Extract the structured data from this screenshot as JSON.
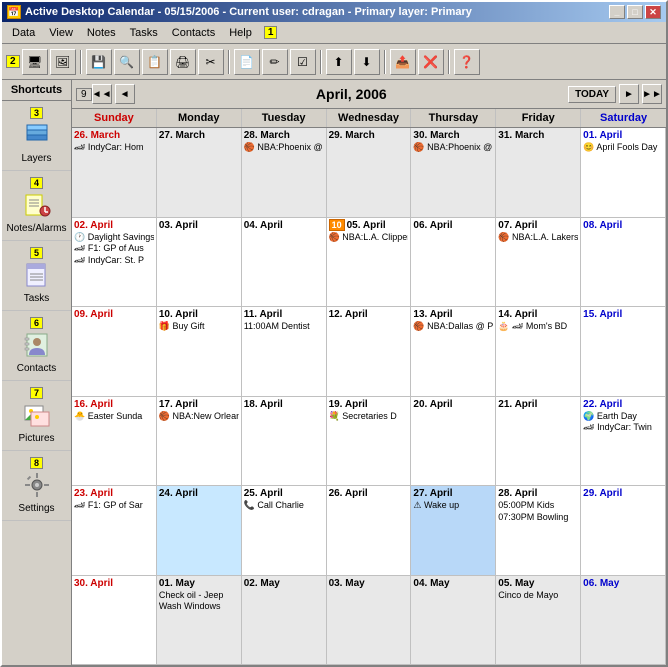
{
  "window": {
    "title": "Active Desktop Calendar - 05/15/2006 - Current user: cdragan - Primary layer: Primary",
    "icon": "📅"
  },
  "titlebar_buttons": [
    "_",
    "□",
    "✕"
  ],
  "menubar": {
    "items": [
      "Data",
      "View",
      "Notes",
      "Tasks",
      "Contacts",
      "Help"
    ],
    "badge": "1"
  },
  "toolbar": {
    "badge": "2",
    "buttons": [
      "🖥",
      "🖼",
      "💾",
      "🔍",
      "📋",
      "🖨",
      "✂",
      "📄",
      "✏",
      "☑",
      "⬆",
      "⬇",
      "📤",
      "❌",
      "❓"
    ]
  },
  "sidebar": {
    "title": "Shortcuts",
    "items": [
      {
        "id": "layers",
        "label": "Layers",
        "num": "3"
      },
      {
        "id": "notes-alarms",
        "label": "Notes/Alarms",
        "num": "4"
      },
      {
        "id": "tasks",
        "label": "Tasks",
        "num": "5"
      },
      {
        "id": "contacts",
        "label": "Contacts",
        "num": "6"
      },
      {
        "id": "pictures",
        "label": "Pictures",
        "num": "7"
      },
      {
        "id": "settings",
        "label": "Settings",
        "num": "8"
      }
    ]
  },
  "calendar": {
    "title": "April, 2006",
    "badge": "9",
    "nav_buttons": [
      "◄◄",
      "◄",
      "TODAY",
      "►",
      "►►"
    ],
    "days": [
      "Sunday",
      "Monday",
      "Tuesday",
      "Wednesday",
      "Thursday",
      "Friday",
      "Saturday"
    ],
    "weeks": [
      [
        {
          "date": "26. March",
          "month": "other",
          "events": [
            "🏎 IndyCar: Hom"
          ]
        },
        {
          "date": "27. March",
          "month": "other",
          "events": []
        },
        {
          "date": "28. March",
          "month": "other",
          "events": [
            "🏀 NBA:Phoenix @"
          ]
        },
        {
          "date": "29. March",
          "month": "other",
          "events": []
        },
        {
          "date": "30. March",
          "month": "other",
          "events": [
            "🏀 NBA:Phoenix @"
          ]
        },
        {
          "date": "31. March",
          "month": "other",
          "events": []
        },
        {
          "date": "01. April",
          "month": "current",
          "events": [
            "😊 April Fools Day"
          ]
        }
      ],
      [
        {
          "date": "02. April",
          "month": "current",
          "events": [
            "🕐 Daylight Savings",
            "🏎 F1: GP of Aus",
            "🏎 IndyCar: St. P"
          ]
        },
        {
          "date": "03. April",
          "month": "current",
          "events": []
        },
        {
          "date": "04. April",
          "month": "current",
          "events": []
        },
        {
          "date": "05. April",
          "month": "current",
          "badge": "10",
          "events": [
            "🏀 NBA:L.A. Clipper"
          ]
        },
        {
          "date": "06. April",
          "month": "current",
          "events": []
        },
        {
          "date": "07. April",
          "month": "current",
          "events": [
            "🏀 NBA:L.A. Lakers"
          ]
        },
        {
          "date": "08. April",
          "month": "current",
          "events": []
        }
      ],
      [
        {
          "date": "09. April",
          "month": "current",
          "events": []
        },
        {
          "date": "10. April",
          "month": "current",
          "events": [
            "🎁 Buy Gift"
          ]
        },
        {
          "date": "11. April",
          "month": "current",
          "events": [
            "11:00AM Dentist"
          ]
        },
        {
          "date": "12. April",
          "month": "current",
          "events": []
        },
        {
          "date": "13. April",
          "month": "current",
          "events": [
            "🏀 NBA:Dallas @ Ph"
          ]
        },
        {
          "date": "14. April",
          "month": "current",
          "events": [
            "🎂 🏎 Mom's BD"
          ]
        },
        {
          "date": "15. April",
          "month": "current",
          "events": []
        }
      ],
      [
        {
          "date": "16. April",
          "month": "current",
          "events": [
            "🐣 Easter Sunda"
          ]
        },
        {
          "date": "17. April",
          "month": "current",
          "events": [
            "🏀 NBA:New Orlean"
          ]
        },
        {
          "date": "18. April",
          "month": "current",
          "events": []
        },
        {
          "date": "19. April",
          "month": "current",
          "events": [
            "💐 Secretaries D"
          ]
        },
        {
          "date": "20. April",
          "month": "current",
          "events": []
        },
        {
          "date": "21. April",
          "month": "current",
          "events": []
        },
        {
          "date": "22. April",
          "month": "current",
          "events": [
            "🌍 Earth Day",
            "🏎 IndyCar: Twin"
          ]
        }
      ],
      [
        {
          "date": "23. April",
          "month": "current",
          "events": [
            "🏎 F1: GP of Sar"
          ]
        },
        {
          "date": "24. April",
          "month": "current",
          "events": [],
          "highlighted": true
        },
        {
          "date": "25. April",
          "month": "current",
          "events": [
            "📞 Call Charlie"
          ]
        },
        {
          "date": "26. April",
          "month": "current",
          "events": []
        },
        {
          "date": "27. April",
          "month": "current",
          "selected": true,
          "events": [
            "⚠ Wake up"
          ]
        },
        {
          "date": "28. April",
          "month": "current",
          "events": [
            "05:00PM Kids",
            "07:30PM Bowling"
          ]
        },
        {
          "date": "29. April",
          "month": "current",
          "events": []
        }
      ],
      [
        {
          "date": "30. April",
          "month": "current",
          "events": []
        },
        {
          "date": "01. May",
          "month": "other",
          "events": [
            "Check oil - Jeep",
            "Wash Windows"
          ]
        },
        {
          "date": "02. May",
          "month": "other",
          "events": []
        },
        {
          "date": "03. May",
          "month": "other",
          "events": []
        },
        {
          "date": "04. May",
          "month": "other",
          "events": []
        },
        {
          "date": "05. May",
          "month": "other",
          "events": [
            "Cinco de Mayo"
          ]
        },
        {
          "date": "06. May",
          "month": "other",
          "events": []
        }
      ]
    ]
  }
}
